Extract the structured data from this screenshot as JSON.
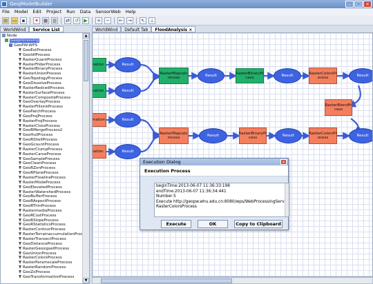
{
  "window": {
    "title": "GeoJModelBuilder",
    "buttons": [
      "–",
      "□",
      "×"
    ]
  },
  "menu": [
    "File",
    "Model",
    "Edit",
    "Project",
    "Run",
    "Data",
    "SensorWeb",
    "Help"
  ],
  "toolbar_icons": [
    "new-icon",
    "open-icon",
    "save-icon",
    "import-icon",
    "export-icon",
    "copy-icon",
    "paste-icon",
    "undo-icon",
    "run-icon",
    "zoom-in-icon",
    "zoom-out-icon",
    "back-icon",
    "forward-icon",
    "select-icon",
    "link-icon"
  ],
  "left_tabs": [
    "WorldWind",
    "Service List"
  ],
  "tree": {
    "root": "Node",
    "group": "Geoprocessing",
    "service": "GeoPW-WPS",
    "items": [
      "GeoExtProcess",
      "GeoIdfProcess",
      "RasterQuantProcess",
      "RasterFilderProcess",
      "RasterBinaryProcess",
      "RasterUnionProcess",
      "GeoTopologyProcess",
      "GeoDissolveProcess",
      "RasterRedcedProcess",
      "RasterSurfaceProcess",
      "RasterCompositeProcess",
      "GeoOverlayProcess",
      "RasterFillsinkProcess",
      "GeoPatchProcess",
      "GeoProjProcess",
      "RasterProjProcess",
      "RasterClossProcess",
      "GeoRMergeProcess2",
      "GeoHullProcess",
      "GeoRShellProcess",
      "GeoGcountProcess",
      "RasterClumpProcess",
      "RasterCarveProcess",
      "GeoSampleProcess",
      "GeoCleanProcess",
      "GeoRZonProcess",
      "GeoRPlaneProcess",
      "RasterFlowlineProcess",
      "RasterModeProcess",
      "GeoElevatedProcess",
      "RasterWatershedProcess",
      "GeoBufferProcess",
      "GeoRAspectProcess",
      "GeoRThinProcess",
      "RastermediaProcess",
      "GeoRCostProcess",
      "GeoRSlopeProcess",
      "GeoRStatisticsProcess",
      "RasterContourProcess",
      "RasterTerrainaccumulationProcess",
      "RasterTransectProcess",
      "GeoDistanceProcess",
      "RasterGeosigsetProcess",
      "GeoUnionProcess",
      "RasterColorsProcess",
      "RasterParamscaleProcess",
      "RasterRandomProcess",
      "GeoZoProcess",
      "GeoTransformationProcess"
    ]
  },
  "editor_tabs": [
    {
      "label": "WorldWind",
      "active": false
    },
    {
      "label": "Default Tab",
      "active": false
    },
    {
      "label": "FloodAnalysis ×",
      "active": true
    }
  ],
  "workflow": {
    "nodes": [
      {
        "label": "mation",
        "kind": "green"
      },
      {
        "label": "Result",
        "kind": "ell"
      },
      {
        "label": "RasterMapcalc rocess",
        "kind": "green"
      },
      {
        "label": "Result",
        "kind": "ell"
      },
      {
        "label": "RasterBinaryPr cess",
        "kind": "green"
      },
      {
        "label": "Result",
        "kind": "ell"
      },
      {
        "label": "RasterColorsPr ocess",
        "kind": "orange"
      },
      {
        "label": "Result",
        "kind": "ell"
      },
      {
        "label": "ination",
        "kind": "green"
      },
      {
        "label": "Result",
        "kind": "ell"
      },
      {
        "label": "RasterBlendPr cess",
        "kind": "orange"
      },
      {
        "label": "formation",
        "kind": "orange"
      },
      {
        "label": "Result",
        "kind": "ell"
      },
      {
        "label": "RasterMapcalc rocess",
        "kind": "orange"
      },
      {
        "label": "Result",
        "kind": "ell"
      },
      {
        "label": "RasterBinaryPr cess",
        "kind": "orange"
      },
      {
        "label": "Result",
        "kind": "ell"
      },
      {
        "label": "RasterColorsPr ocess",
        "kind": "orange"
      },
      {
        "label": "Result",
        "kind": "ell"
      },
      {
        "label": "mation",
        "kind": "orange"
      },
      {
        "label": "Result",
        "kind": "ell"
      }
    ]
  },
  "dialog": {
    "title": "Execution Dialog",
    "heading": "Execution Process",
    "log": [
      "beginTime:2013-06-07 11:36:33:198",
      "endTime:2013-06-07 11:36:34:441",
      "Number:5",
      "Execute http://geopw.whu.edu.cn:8080/wps/WebProcessingService@",
      "RasterColorsProcess"
    ],
    "buttons": {
      "execute": "Execute",
      "ok": "OK",
      "clipboard": "Copy to Clipboard"
    }
  }
}
